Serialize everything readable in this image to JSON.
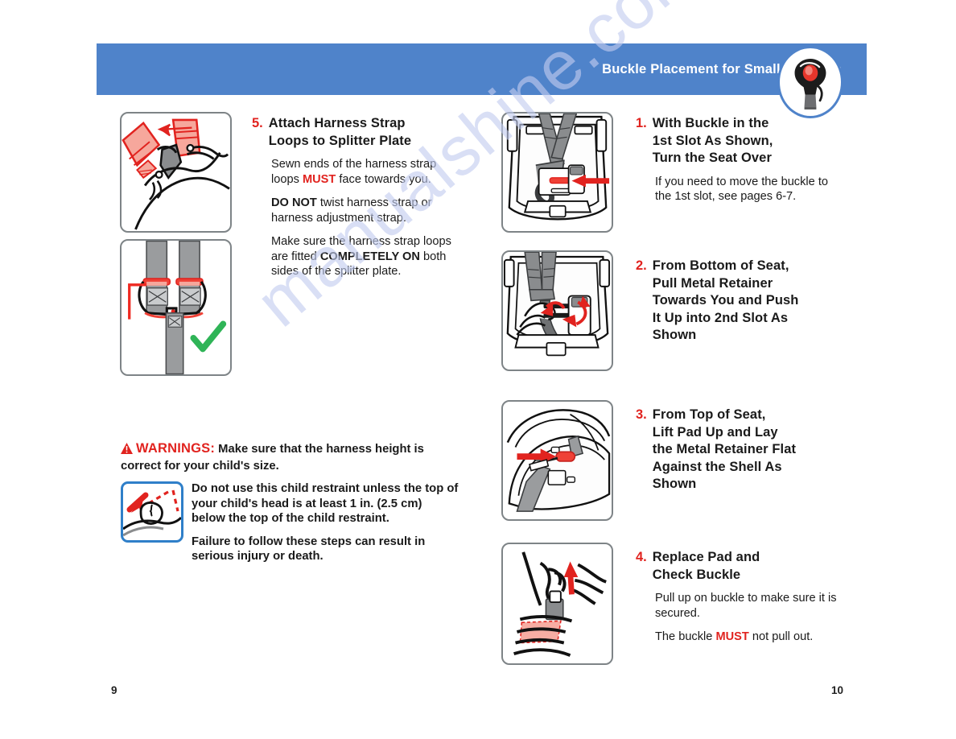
{
  "header": {
    "title": "Buckle Placement for Smaller Infants",
    "bar_color": "#4f83ca",
    "logo_icon": "buckle-logo-icon"
  },
  "watermark": {
    "text": "manualshine.com"
  },
  "accent": {
    "red": "#e1231f",
    "blue": "#4f83ca",
    "green": "#2fb457",
    "grey": "#7e8487"
  },
  "left_column": {
    "panels": [
      {
        "name": "attach-harness-loops-illustration",
        "alt": "Hands attaching red harness strap loops onto the splitter plate"
      },
      {
        "name": "splitter-plate-correct-illustration",
        "alt": "Harness strap loops fitted completely on both sides of splitter plate with green check mark"
      }
    ],
    "step": {
      "number": "5.",
      "title_line1": "Attach Harness Strap",
      "title_line2": "Loops to Splitter Plate",
      "para1_a": "Sewn ends of the harness strap loops ",
      "para1_must": "MUST",
      "para1_b": " face towards you.",
      "para2_a": "DO NOT",
      "para2_b": " twist harness strap or harness adjustment strap.",
      "para3_a": "Make sure the harness strap loops are fitted ",
      "para3_bold": "COMPLETELY ON",
      "para3_b": " both sides of the splitter plate."
    }
  },
  "warnings": {
    "icon": "warning-triangle-icon",
    "label": "WARNINGS:",
    "lead": " Make sure that the harness height is correct for your child's size.",
    "picto": {
      "name": "head-clearance-icon",
      "alt": "Child head must be at least 1 in. below top of child restraint"
    },
    "body1": "Do not use this child restraint unless the top of your child's head is at least 1 in. (2.5 cm) below the top of the child restraint.",
    "body2": "Failure to follow these steps can result in serious injury or death."
  },
  "right_column": {
    "steps": [
      {
        "number": "1.",
        "title_lines": [
          "With Buckle in the",
          "1st Slot As Shown,",
          "Turn the Seat Over"
        ],
        "body": "If you need to move the buckle to the 1st slot, see pages 6-7.",
        "panel": {
          "name": "buckle-first-slot-illustration",
          "alt": "Seat shown with buckle in the 1st slot and red arrow pointing to it"
        }
      },
      {
        "number": "2.",
        "title_lines": [
          "From Bottom of Seat,",
          "Pull Metal Retainer",
          "Towards You and Push",
          "It Up into 2nd Slot As",
          "Shown"
        ],
        "body": "",
        "panel": {
          "name": "pull-metal-retainer-illustration",
          "alt": "Hand pulling metal retainer from bottom of seat with curved red arrows"
        }
      },
      {
        "number": "3.",
        "title_lines": [
          "From Top of Seat,",
          "Lift Pad Up and Lay",
          "the Metal Retainer Flat",
          "Against the Shell As",
          "Shown"
        ],
        "body": "",
        "panel": {
          "name": "lay-retainer-flat-illustration",
          "alt": "Pad lifted from top of seat with red arrow pointing at metal retainer lying flat"
        }
      },
      {
        "number": "4.",
        "title_lines": [
          "Replace Pad and",
          "Check Buckle"
        ],
        "body1": "Pull up on buckle to make sure it is secured.",
        "body2_a": "The buckle ",
        "body2_must": "MUST",
        "body2_b": " not pull out.",
        "panel": {
          "name": "check-buckle-illustration",
          "alt": "Hand pulling up on the buckle with red upward arrow"
        }
      }
    ]
  },
  "folios": {
    "left": "9",
    "right": "10"
  }
}
